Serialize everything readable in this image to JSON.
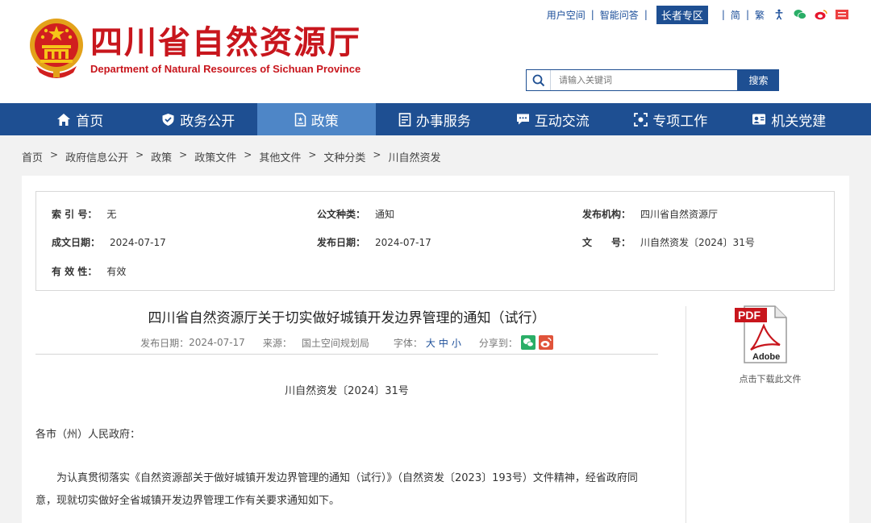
{
  "header": {
    "title": "四川省自然资源厅",
    "subtitle": "Department of Natural Resources of Sichuan Province",
    "emblem_icon": "national-emblem-icon"
  },
  "toplinks": {
    "user_space": "用户空间",
    "smart_qa": "智能问答",
    "elder_zone": "长者专区",
    "simplified": "简",
    "traditional": "繁",
    "icons": [
      "accessibility-icon",
      "wechat-icon",
      "weibo-icon",
      "toutiao-icon"
    ]
  },
  "search": {
    "placeholder": "请输入关键词",
    "button": "搜索"
  },
  "nav": {
    "items": [
      {
        "label": "首页",
        "icon": "home-icon"
      },
      {
        "label": "政务公开",
        "icon": "shield-icon"
      },
      {
        "label": "政策",
        "icon": "document-icon"
      },
      {
        "label": "办事服务",
        "icon": "list-icon"
      },
      {
        "label": "互动交流",
        "icon": "chat-icon"
      },
      {
        "label": "专项工作",
        "icon": "focus-icon"
      },
      {
        "label": "机关党建",
        "icon": "party-icon"
      }
    ],
    "active_index": 2
  },
  "breadcrumb": [
    "首页",
    "政府信息公开",
    "政策",
    "政策文件",
    "其他文件",
    "文种分类",
    "川自然资发"
  ],
  "meta": {
    "index_label": "索 引 号：",
    "index_value": "无",
    "type_label": "公文种类：",
    "type_value": "通知",
    "org_label": "发布机构：",
    "org_value": "四川省自然资源厅",
    "created_label": "成文日期：",
    "created_value": "2024-07-17",
    "published_label": "发布日期：",
    "published_value": "2024-07-17",
    "docno_label": "文　　号：",
    "docno_value": "川自然资发〔2024〕31号",
    "valid_label": "有 效 性：",
    "valid_value": "有效"
  },
  "article": {
    "title": "四川省自然资源厅关于切实做好城镇开发边界管理的通知（试行）",
    "date_label": "发布日期：",
    "date_value": "2024-07-17",
    "source_label": "来源：",
    "source_value": "国土空间规划局",
    "font_label": "字体：",
    "font_large": "大",
    "font_medium": "中",
    "font_small": "小",
    "share_label": "分享到：",
    "doc_number": "川自然资发〔2024〕31号",
    "salutation": "各市（州）人民政府：",
    "paragraph1": "为认真贯彻落实《自然资源部关于做好城镇开发边界管理的通知（试行）》（自然资发〔2023〕193号）文件精神，经省政府同意，现就切实做好全省城镇开发边界管理工作有关要求通知如下。"
  },
  "download": {
    "pdf_badge": "PDF",
    "adobe_label": "Adobe",
    "caption": "点击下载此文件"
  },
  "colors": {
    "brand_red": "#c8161d",
    "nav_blue": "#1e4f92",
    "nav_active": "#4e86c7"
  }
}
